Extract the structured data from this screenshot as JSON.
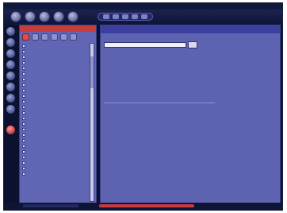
{
  "window": {
    "title": ""
  },
  "toolbar": {
    "nav_buttons": [
      "back",
      "forward",
      "up",
      "refresh"
    ]
  },
  "sidebar": {
    "header": "",
    "tool_icons": [
      "folder-icon",
      "star-icon",
      "link-icon",
      "copy-icon",
      "grid-icon",
      "delete-icon"
    ],
    "items": [
      {
        "label": ""
      },
      {
        "label": ""
      },
      {
        "label": ""
      },
      {
        "label": ""
      },
      {
        "label": ""
      },
      {
        "label": ""
      },
      {
        "label": ""
      },
      {
        "label": ""
      },
      {
        "label": ""
      },
      {
        "label": ""
      },
      {
        "label": ""
      },
      {
        "label": ""
      },
      {
        "label": ""
      },
      {
        "label": ""
      },
      {
        "label": ""
      },
      {
        "label": ""
      },
      {
        "label": ""
      },
      {
        "label": ""
      },
      {
        "label": ""
      },
      {
        "label": ""
      },
      {
        "label": ""
      },
      {
        "label": ""
      },
      {
        "label": ""
      },
      {
        "label": ""
      }
    ],
    "note": ""
  },
  "main": {
    "header": "",
    "field_label": "",
    "field_value": "",
    "button_label": ""
  },
  "status": {
    "text": ""
  },
  "colors": {
    "frame": "#0b1230",
    "panel": "#6066b4",
    "accent_red": "#c93c3c",
    "main_bg": "#5d63b0"
  }
}
